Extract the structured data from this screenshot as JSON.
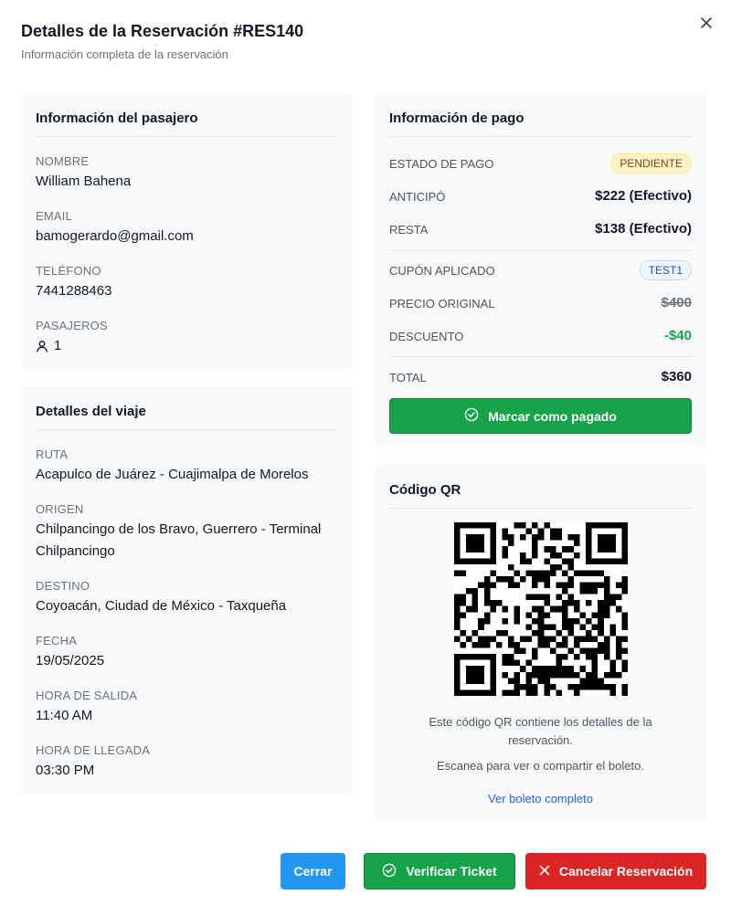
{
  "header": {
    "title": "Detalles de la Reservación #RES140",
    "subtitle": "Información completa de la reservación"
  },
  "passenger": {
    "title": "Información del pasajero",
    "name_label": "NOMBRE",
    "name": "William Bahena",
    "email_label": "EMAIL",
    "email": "bamogerardo@gmail.com",
    "phone_label": "TELÉFONO",
    "phone": "7441288463",
    "passengers_label": "PASAJEROS",
    "passengers": "1"
  },
  "trip": {
    "title": "Detalles del viaje",
    "route_label": "RUTA",
    "route": "Acapulco de Juárez - Cuajimalpa de Morelos",
    "origin_label": "ORIGEN",
    "origin": "Chilpancingo de los Bravo, Guerrero - Terminal Chilpancingo",
    "destination_label": "DESTINO",
    "destination": "Coyoacán, Ciudad de México - Taxqueña",
    "date_label": "FECHA",
    "date": "19/05/2025",
    "departure_label": "HORA DE SALIDA",
    "departure": "11:40 AM",
    "arrival_label": "HORA DE LLEGADA",
    "arrival": "03:30 PM"
  },
  "payment": {
    "title": "Información de pago",
    "status_label": "ESTADO DE PAGO",
    "status": "PENDIENTE",
    "advance_label": "ANTICIPÓ",
    "advance": "$222 (Efectivo)",
    "remaining_label": "RESTA",
    "remaining": "$138 (Efectivo)",
    "coupon_label": "CUPÓN APLICADO",
    "coupon": "TEST1",
    "original_price_label": "PRECIO ORIGINAL",
    "original_price": "$400",
    "discount_label": "DESCUENTO",
    "discount": "-$40",
    "total_label": "TOTAL",
    "total": "$360",
    "mark_paid_label": "Marcar como pagado"
  },
  "qr": {
    "title": "Código QR",
    "note": "Este código QR contiene los detalles de la reservación.",
    "scan_note": "Escanea para ver o compartir el boleto.",
    "link": "Ver boleto completo"
  },
  "footer": {
    "close_label": "Cerrar",
    "verify_label": "Verificar Ticket",
    "cancel_label": "Cancelar Reservación"
  },
  "colors": {
    "accent_green": "#16a34a",
    "accent_blue": "#2196f3",
    "accent_red": "#dc2626",
    "badge_pending": "#fef3c7",
    "card_bg": "#f8f9fa"
  },
  "icons": {
    "close": "close-icon",
    "user": "user-icon",
    "check_circle": "check-circle-icon",
    "cancel_x": "x-icon"
  }
}
